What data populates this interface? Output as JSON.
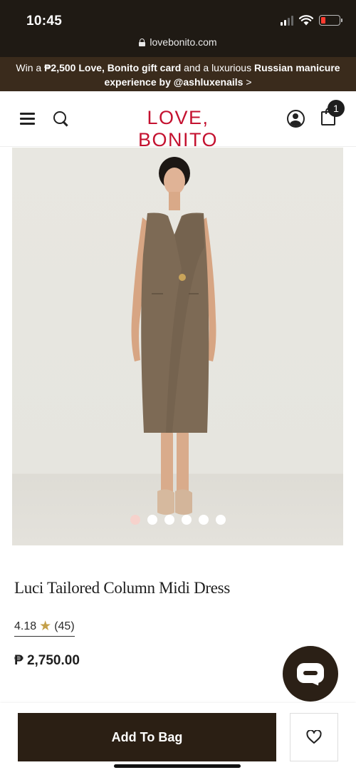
{
  "status_bar": {
    "time": "10:45"
  },
  "browser": {
    "url": "lovebonito.com"
  },
  "promo": {
    "text_1": "Win a ",
    "bold_1": "₱2,500 Love, Bonito gift card",
    "text_2": " and a luxurious ",
    "bold_2": "Russian manicure experience by @ashluxenails",
    "text_3": " >"
  },
  "header": {
    "logo": "LOVE, BONITO",
    "cart_count": "1"
  },
  "carousel": {
    "count": 6,
    "active_index": 0
  },
  "product": {
    "title": "Luci Tailored Column Midi Dress",
    "rating_value": "4.18",
    "rating_star": "★",
    "review_count": "(45)",
    "price": "₱ 2,750.00"
  },
  "actions": {
    "add_to_bag": "Add To Bag"
  },
  "colors": {
    "brand_red": "#c41230",
    "dark_brown": "#2b1f14",
    "promo_bg": "#3a2b1c",
    "dress": "#7d6a55",
    "star": "#c4a04a"
  }
}
